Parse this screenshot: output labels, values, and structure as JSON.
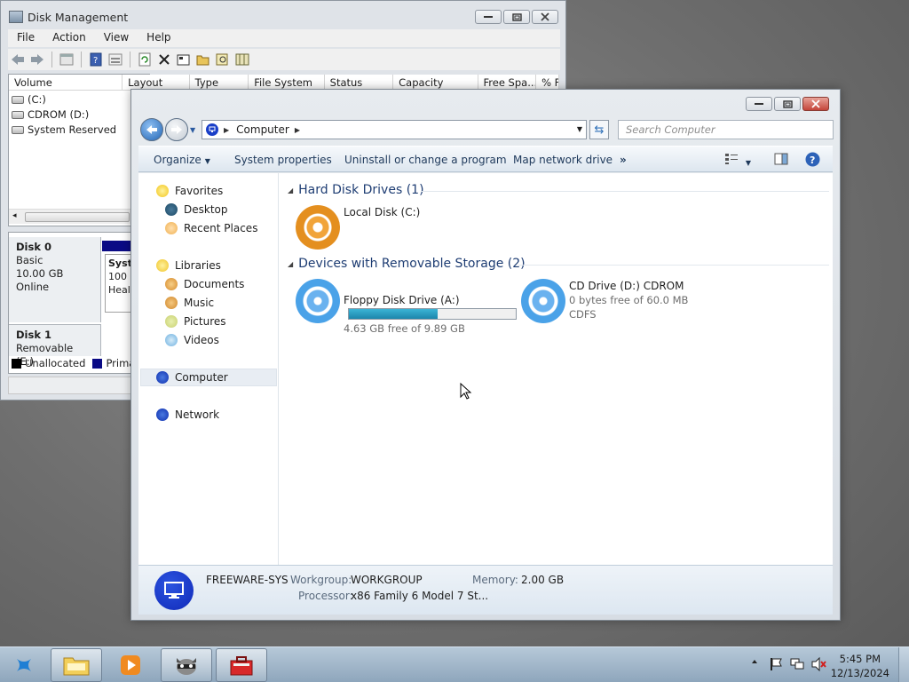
{
  "disk_management": {
    "title": "Disk Management",
    "menu": [
      "File",
      "Action",
      "View",
      "Help"
    ],
    "columns": [
      "Volume",
      "Layout",
      "Type",
      "File System",
      "Status",
      "Capacity",
      "Free Spa...",
      "% F"
    ],
    "volumes": [
      "(C:)",
      "CDROM (D:)",
      "System Reserved"
    ],
    "disk0": {
      "name": "Disk 0",
      "type": "Basic",
      "size": "10.00 GB",
      "status": "Online",
      "partition_lines": [
        "Syste",
        "100 M",
        "Healt"
      ]
    },
    "disk1": {
      "name": "Disk 1",
      "type": "Removable (E:)"
    },
    "legend": [
      {
        "label": "Unallocated",
        "color": "#000000"
      },
      {
        "label": "Prima",
        "color": "#0a0a85"
      }
    ]
  },
  "explorer": {
    "breadcrumb": "Computer",
    "search_placeholder": "Search Computer",
    "commands": {
      "organize": "Organize",
      "system_properties": "System properties",
      "uninstall": "Uninstall or change a program",
      "map_drive": "Map network drive",
      "more": "»"
    },
    "nav": {
      "favorites": "Favorites",
      "desktop": "Desktop",
      "recent": "Recent Places",
      "libraries": "Libraries",
      "documents": "Documents",
      "music": "Music",
      "pictures": "Pictures",
      "videos": "Videos",
      "computer": "Computer",
      "network": "Network"
    },
    "groups": {
      "hdd": "Hard Disk Drives (1)",
      "removable": "Devices with Removable Storage (2)"
    },
    "items": {
      "local_disk": {
        "name": "Local Disk (C:)",
        "free": "4.63 GB free of 9.89 GB",
        "used_fraction": 0.532
      },
      "floppy": {
        "name": "Floppy Disk Drive (A:)"
      },
      "cd": {
        "name": "CD Drive (D:) CDROM",
        "free": "0 bytes free of 60.0 MB",
        "fs": "CDFS"
      }
    },
    "details": {
      "pc_name": "FREEWARE-SYS",
      "workgroup_label": "Workgroup:",
      "workgroup": "WORKGROUP",
      "memory_label": "Memory:",
      "memory": "2.00 GB",
      "processor_label": "Processor:",
      "processor": "x86 Family 6 Model 7 St..."
    }
  },
  "taskbar": {
    "time": "5:45 PM",
    "date": "12/13/2024"
  },
  "colors": {
    "hdd_orange": "#e48f1f",
    "removable_blue": "#4aa2e8",
    "usage_fill": "#1c86ab",
    "computer_blue": "#1029b8"
  }
}
